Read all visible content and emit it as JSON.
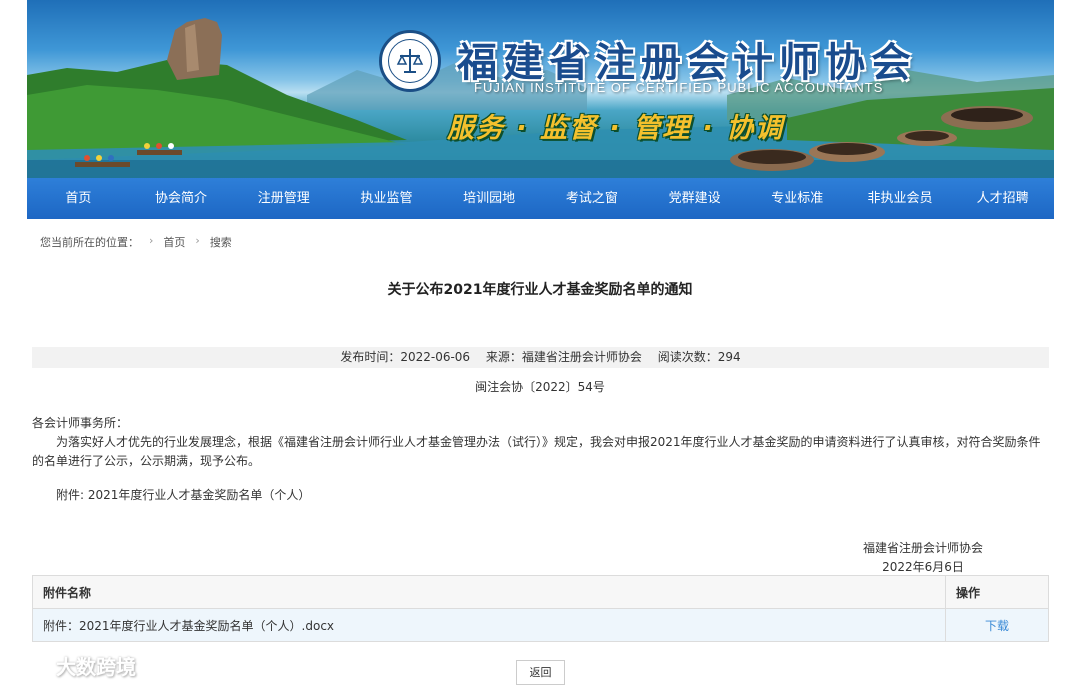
{
  "header": {
    "title_cn": "福建省注册会计师协会",
    "title_en": "FUJIAN INSTITUTE OF CERTIFIED PUBLIC ACCOUNTANTS",
    "slogan": "服务 · 监督 · 管理 · 协调",
    "logo_icon": "accounting-seal-icon"
  },
  "nav": {
    "items": [
      "首页",
      "协会简介",
      "注册管理",
      "执业监管",
      "培训园地",
      "考试之窗",
      "党群建设",
      "专业标准",
      "非执业会员",
      "人才招聘"
    ]
  },
  "breadcrumb": {
    "label": "您当前所在的位置：",
    "home": "首页",
    "current": "搜索"
  },
  "article": {
    "title": "关于公布2021年度行业人才基金奖励名单的通知",
    "publish_time": "发布时间：2022-06-06",
    "source": "来源：福建省注册会计师协会",
    "views": "阅读次数：294",
    "doc_no": "闽注会协〔2022〕54号",
    "salutation": "各会计师事务所：",
    "paragraph": "为落实好人才优先的行业发展理念，根据《福建省注册会计师行业人才基金管理办法（试行）》规定，我会对申报2021年度行业人才基金奖励的申请资料进行了认真审核，对符合奖励条件的名单进行了公示，公示期满，现予公布。",
    "attachment_note": "附件: 2021年度行业人才基金奖励名单（个人）",
    "signature_org": "福建省注册会计师协会",
    "signature_date": "2022年6月6日"
  },
  "attachments": {
    "header_name": "附件名称",
    "header_op": "操作",
    "rows": [
      {
        "name": "附件：2021年度行业人才基金奖励名单（个人）.docx",
        "action": "下载"
      }
    ]
  },
  "back_label": "返回",
  "watermark": "大数跨境",
  "colors": {
    "nav_bg": "#1d67c4",
    "link": "#3a8ad6",
    "title_blue": "#1a4c8e",
    "slogan_gold": "#f4c12d"
  }
}
